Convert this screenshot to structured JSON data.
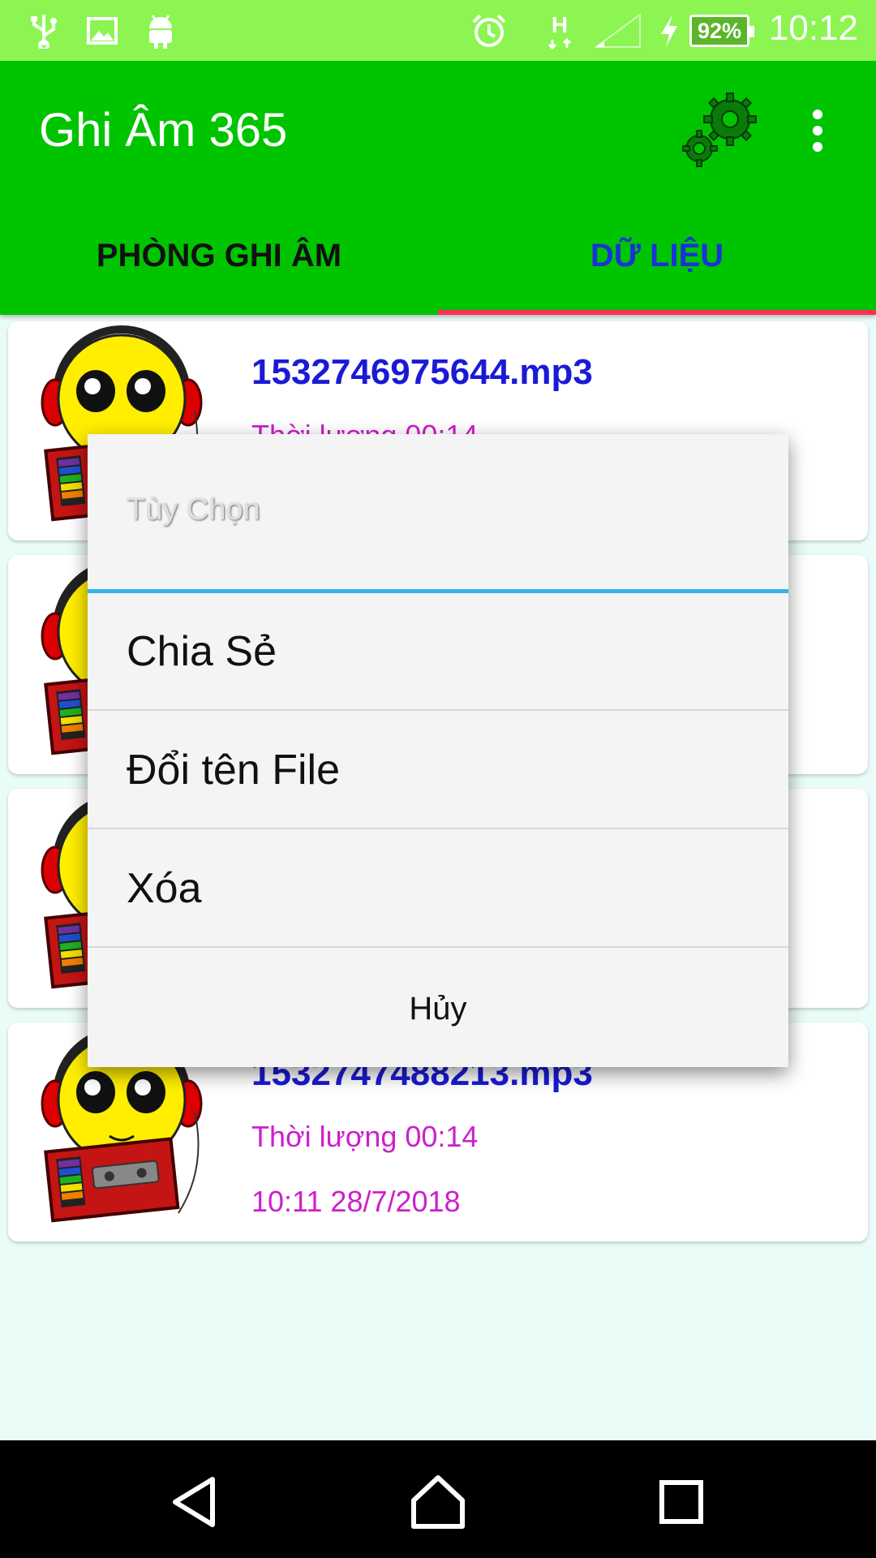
{
  "status_bar": {
    "time": "10:12",
    "battery": "92%",
    "network": "H",
    "icons": [
      "usb-icon",
      "image-icon",
      "android-icon",
      "alarm-icon",
      "network-h-icon",
      "signal-icon",
      "charging-icon",
      "battery-icon"
    ]
  },
  "app_bar": {
    "title": "Ghi Âm 365",
    "actions": [
      "settings-gears-icon",
      "more-vert-icon"
    ]
  },
  "tabs": [
    {
      "label": "PHÒNG GHI ÂM",
      "selected": false
    },
    {
      "label": "DỮ LIỆU",
      "selected": true
    }
  ],
  "recordings": [
    {
      "file": "1532746975644.mp3",
      "duration": "Thời lượng 00:14",
      "date": ""
    },
    {
      "file": "",
      "duration": "",
      "date": ""
    },
    {
      "file": "",
      "duration": "",
      "date": ""
    },
    {
      "file": "1532747488213.mp3",
      "duration": "Thời lượng 00:14",
      "date": "10:11 28/7/2018"
    }
  ],
  "dialog": {
    "title": "Tùy Chọn",
    "options": [
      "Chia Sẻ",
      "Đổi tên File",
      "Xóa"
    ],
    "cancel": "Hủy"
  },
  "colors": {
    "status_bar": "#8cf552",
    "app_bar": "#00c400",
    "tab_indicator": "#ff2d55",
    "file_name": "#1a1ad6",
    "meta_text": "#cc1fcc",
    "dialog_divider": "#33b5e5"
  },
  "nav_bar": [
    "back-icon",
    "home-icon",
    "recents-icon"
  ]
}
